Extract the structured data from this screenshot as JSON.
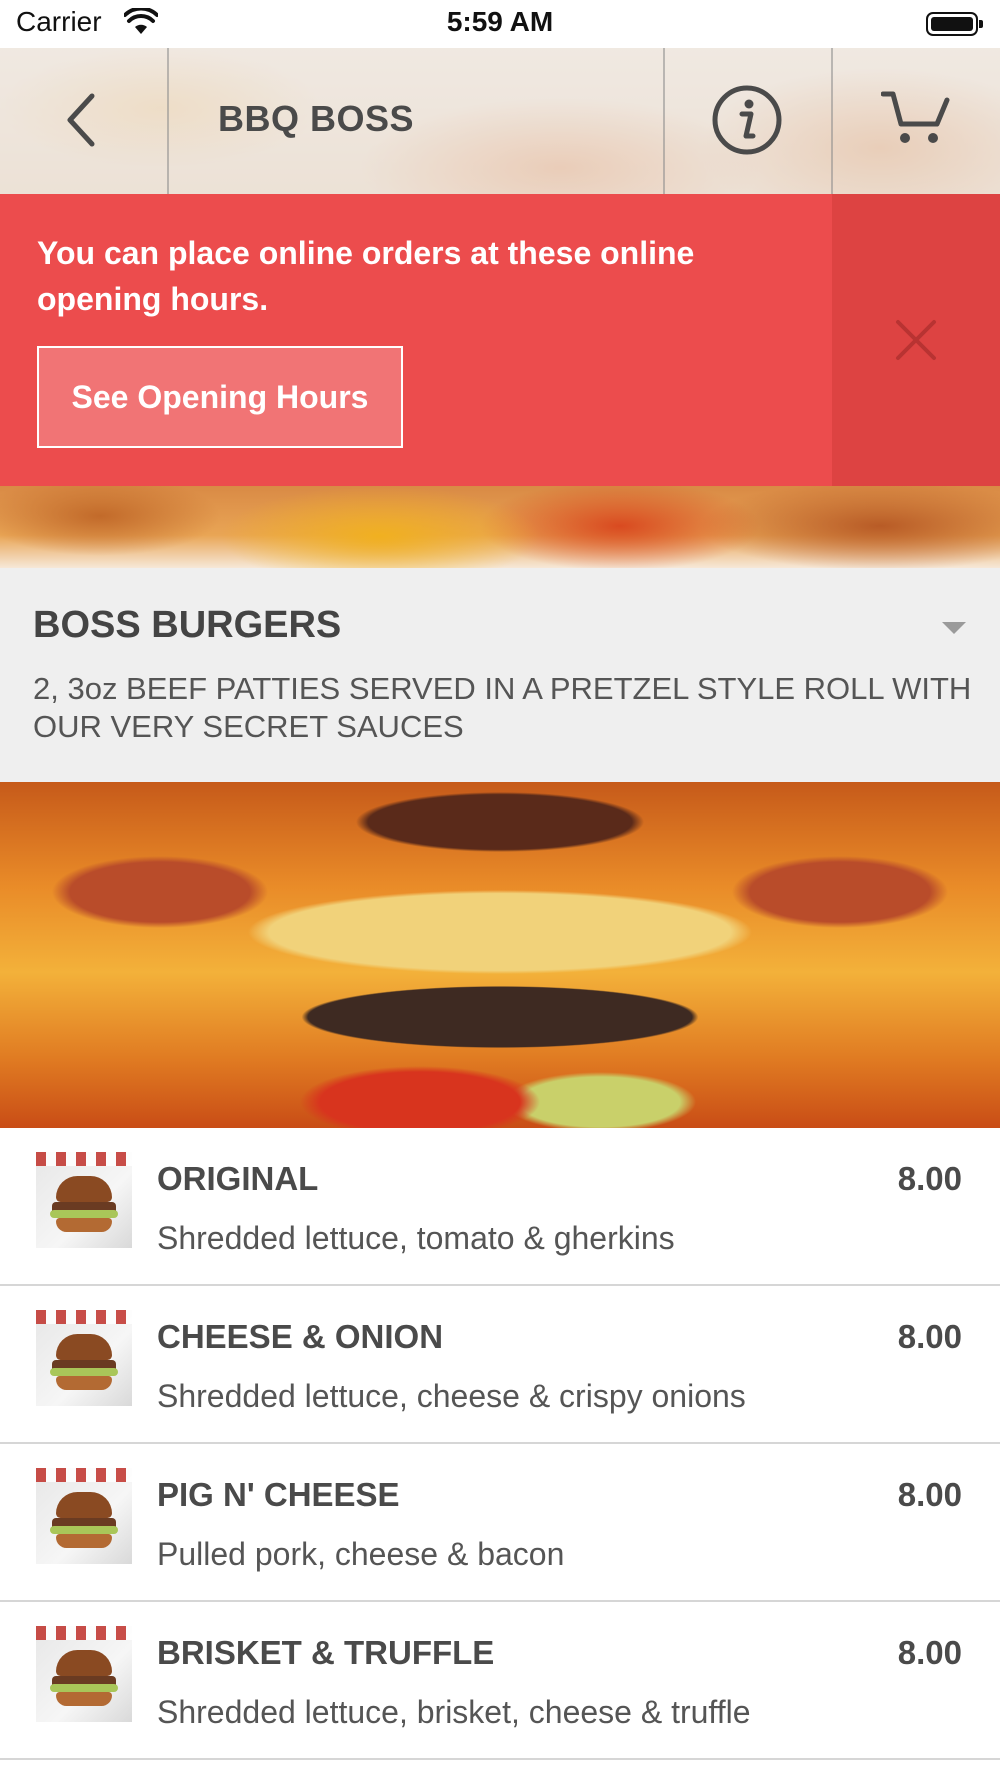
{
  "status_bar": {
    "carrier": "Carrier",
    "time": "5:59 AM"
  },
  "header": {
    "title": "BBQ BOSS"
  },
  "banner": {
    "message": "You can place online orders at these online opening hours.",
    "button_label": "See Opening Hours"
  },
  "category": {
    "title": "BOSS BURGERS",
    "description": "2, 3oz BEEF PATTIES SERVED IN A PRETZEL STYLE ROLL WITH OUR VERY SECRET SAUCES"
  },
  "menu_items": [
    {
      "name": "ORIGINAL",
      "price": "8.00",
      "description": "Shredded lettuce, tomato & gherkins"
    },
    {
      "name": "CHEESE & ONION",
      "price": "8.00",
      "description": "Shredded lettuce, cheese & crispy onions"
    },
    {
      "name": "PIG N' CHEESE",
      "price": "8.00",
      "description": "Pulled pork, cheese & bacon"
    },
    {
      "name": "BRISKET & TRUFFLE",
      "price": "8.00",
      "description": "Shredded lettuce, brisket, cheese & truffle"
    }
  ],
  "colors": {
    "banner": "#ec4c4d",
    "banner_close": "#dd4342",
    "category_bg": "#efefef"
  },
  "icons": [
    "back-icon",
    "info-icon",
    "cart-icon",
    "close-icon",
    "chevron-down-icon",
    "wifi-icon",
    "battery-icon"
  ]
}
